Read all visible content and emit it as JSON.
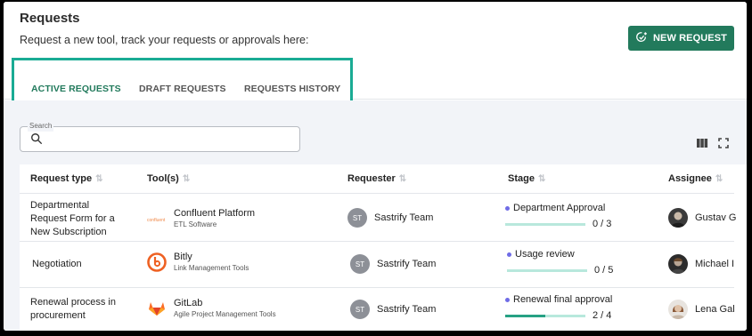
{
  "header": {
    "title": "Requests",
    "subtitle": "Request a new tool, track your requests or approvals here:",
    "new_request_label": "NEW REQUEST"
  },
  "tabs": [
    {
      "label": "ACTIVE REQUESTS",
      "active": true
    },
    {
      "label": "DRAFT REQUESTS",
      "active": false
    },
    {
      "label": "REQUESTS HISTORY",
      "active": false
    }
  ],
  "search": {
    "label": "Search",
    "value": "",
    "placeholder": ""
  },
  "toolbar": {
    "columns_icon": "columns-icon",
    "fullscreen_icon": "fullscreen-icon"
  },
  "table": {
    "headers": [
      "Request type",
      "Tool(s)",
      "Requester",
      "Stage",
      "Assignee"
    ],
    "rows": [
      {
        "request_type": "Departmental Request Form for a New Subscription",
        "tool_name": "Confluent Platform",
        "tool_category": "ETL Software",
        "tool_icon": "confluent-logo",
        "requester_initials": "ST",
        "requester": "Sastrify Team",
        "stage": "Department Approval",
        "progress_text": "0 / 3",
        "progress": 0.0,
        "assignee": "Gustav G"
      },
      {
        "request_type": "Negotiation",
        "tool_name": "Bitly",
        "tool_category": "Link Management Tools",
        "tool_icon": "bitly-logo",
        "requester_initials": "ST",
        "requester": "Sastrify Team",
        "stage": "Usage review",
        "progress_text": "0 / 5",
        "progress": 0.0,
        "assignee": "Michael I"
      },
      {
        "request_type": "Renewal process in procurement",
        "tool_name": "GitLab",
        "tool_category": "Agile Project Management Tools",
        "tool_icon": "gitlab-logo",
        "requester_initials": "ST",
        "requester": "Sastrify Team",
        "stage": "Renewal final approval",
        "progress_text": "2 / 4",
        "progress": 0.5,
        "assignee": "Lena Gal"
      }
    ]
  },
  "colors": {
    "accent": "#227a5c",
    "highlight_border": "#1aab94",
    "stage_dot": "#6f6ce6",
    "progress_fill": "#26a184",
    "progress_track": "#b8e8dc"
  }
}
